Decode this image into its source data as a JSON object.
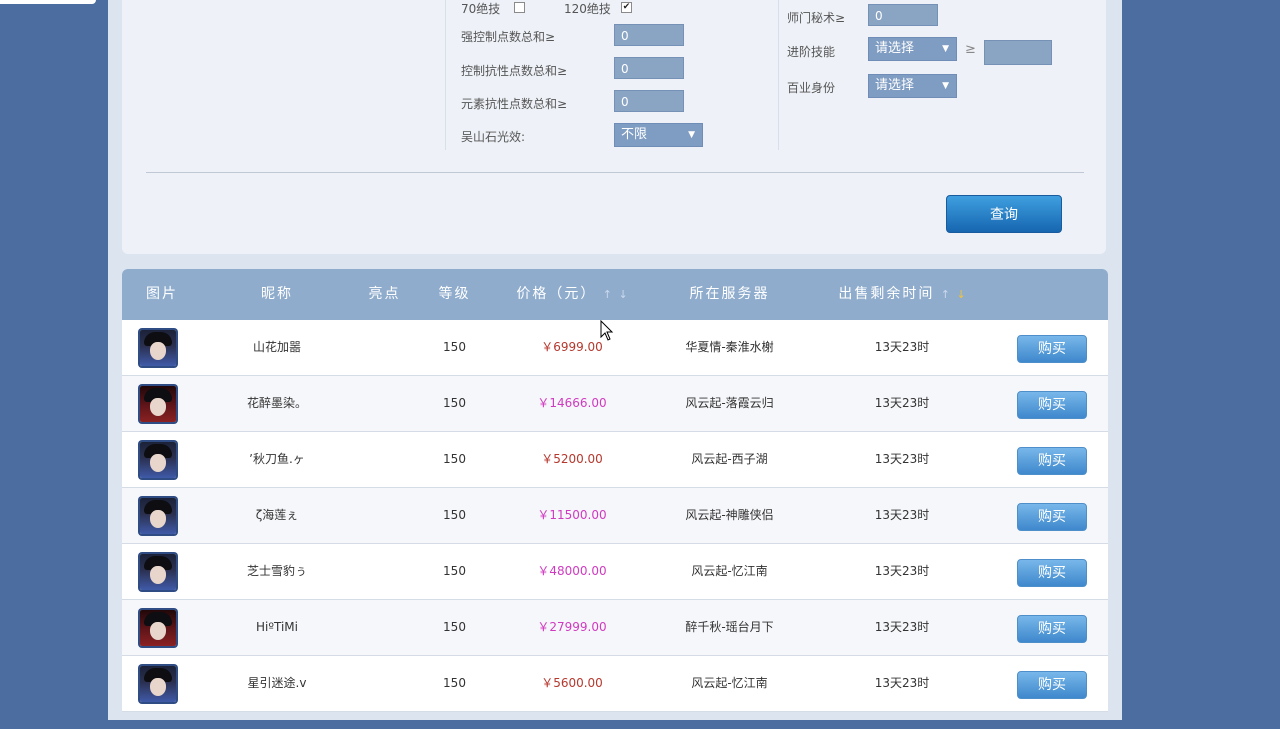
{
  "filters": {
    "skill70_label": "70绝技",
    "skill120_label": "120绝技",
    "strong_control_label": "强控制点数总和≥",
    "strong_control_value": "0",
    "control_resist_label": "控制抗性点数总和≥",
    "control_resist_value": "0",
    "element_resist_label": "元素抗性点数总和≥",
    "element_resist_value": "0",
    "wushan_label": "吴山石光效:",
    "wushan_value": "不限",
    "master_secret_label": "师门秘术≥",
    "master_secret_value": "0",
    "advanced_skill_label": "进阶技能",
    "advanced_skill_select": "请选择",
    "advanced_skill_ge": "≥",
    "profession_label": "百业身份",
    "profession_select": "请选择",
    "query_label": "查询"
  },
  "table": {
    "headers": {
      "image": "图片",
      "nickname": "昵称",
      "highlight": "亮点",
      "level": "等级",
      "price": "价格（元）",
      "server": "所在服务器",
      "remaining": "出售剩余时间"
    },
    "sort_up_icon": "↑",
    "sort_down_icon": "↓",
    "buy_label": "购买",
    "rows": [
      {
        "avatar": "blue",
        "nickname": "山花加噐",
        "level": "150",
        "price": "￥6999.00",
        "price_color": "red",
        "server": "华夏情-秦淮水榭",
        "remaining": "13天23时"
      },
      {
        "avatar": "red",
        "nickname": "花醉墨染。",
        "level": "150",
        "price": "￥14666.00",
        "price_color": "pink",
        "server": "风云起-落霞云归",
        "remaining": "13天23时"
      },
      {
        "avatar": "blue",
        "nickname": "ʼ秋刀鱼.ヶ",
        "level": "150",
        "price": "￥5200.00",
        "price_color": "red",
        "server": "风云起-西子湖",
        "remaining": "13天23时"
      },
      {
        "avatar": "blue",
        "nickname": "ζ海莲ぇ",
        "level": "150",
        "price": "￥11500.00",
        "price_color": "pink",
        "server": "风云起-神雕侠侣",
        "remaining": "13天23时"
      },
      {
        "avatar": "blue",
        "nickname": "芝士雪豹ぅ",
        "level": "150",
        "price": "￥48000.00",
        "price_color": "pink",
        "server": "风云起-忆江南",
        "remaining": "13天23时"
      },
      {
        "avatar": "red",
        "nickname": "HiºTiMi",
        "level": "150",
        "price": "￥27999.00",
        "price_color": "pink",
        "server": "醉千秋-瑶台月下",
        "remaining": "13天23时"
      },
      {
        "avatar": "blue",
        "nickname": "星引迷途.v",
        "level": "150",
        "price": "￥5600.00",
        "price_color": "red",
        "server": "风云起-忆江南",
        "remaining": "13天23时"
      }
    ]
  },
  "colors": {
    "background": "#4c6da0",
    "header": "#8faccd",
    "price_red": "#b5382d",
    "price_pink": "#d03ac1",
    "buy_button": "#3e88cc"
  }
}
